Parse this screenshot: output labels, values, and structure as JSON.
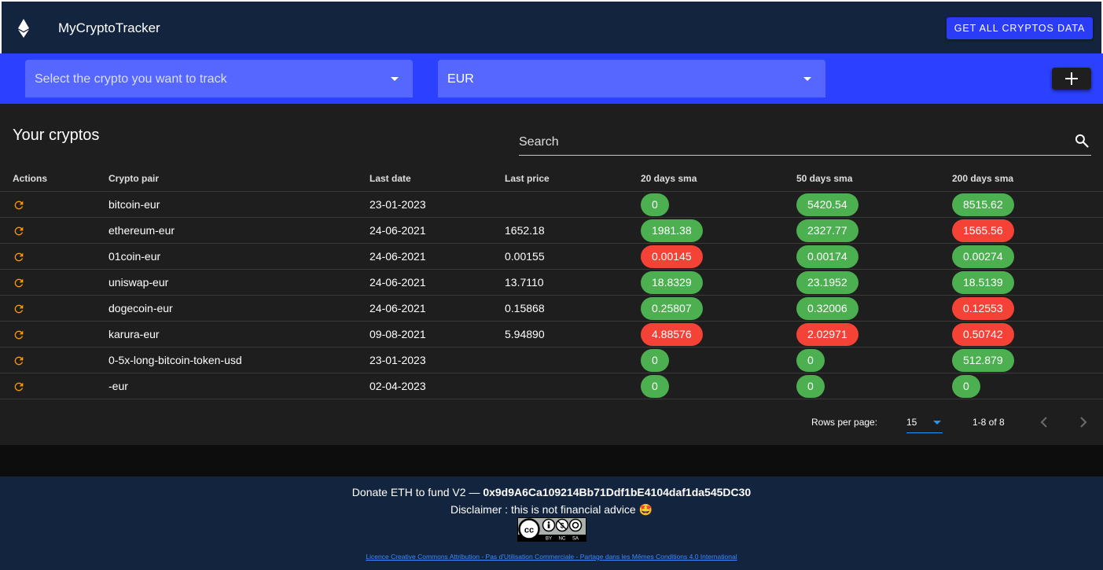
{
  "app": {
    "title": "MyCryptoTracker",
    "get_all_label": "GET ALL CRYPTOS DATA",
    "logo_icon": "ethereum-icon"
  },
  "selectors": {
    "crypto_placeholder": "Select the crypto you want to track",
    "currency_value": "EUR",
    "add_icon": "plus-icon"
  },
  "panel": {
    "title": "Your cryptos",
    "search_placeholder": "Search"
  },
  "table": {
    "headers": [
      "Actions",
      "Crypto pair",
      "Last date",
      "Last price",
      "20 days sma",
      "50 days sma",
      "200 days sma"
    ],
    "rows": [
      {
        "pair": "bitcoin-eur",
        "date": "23-01-2023",
        "price": "",
        "sma20": "0",
        "sma20_color": "green",
        "sma50": "5420.54",
        "sma50_color": "green",
        "sma200": "8515.62",
        "sma200_color": "green"
      },
      {
        "pair": "ethereum-eur",
        "date": "24-06-2021",
        "price": "1652.18",
        "sma20": "1981.38",
        "sma20_color": "green",
        "sma50": "2327.77",
        "sma50_color": "green",
        "sma200": "1565.56",
        "sma200_color": "red"
      },
      {
        "pair": "01coin-eur",
        "date": "24-06-2021",
        "price": "0.00155",
        "sma20": "0.00145",
        "sma20_color": "red",
        "sma50": "0.00174",
        "sma50_color": "green",
        "sma200": "0.00274",
        "sma200_color": "green"
      },
      {
        "pair": "uniswap-eur",
        "date": "24-06-2021",
        "price": "13.7110",
        "sma20": "18.8329",
        "sma20_color": "green",
        "sma50": "23.1952",
        "sma50_color": "green",
        "sma200": "18.5139",
        "sma200_color": "green"
      },
      {
        "pair": "dogecoin-eur",
        "date": "24-06-2021",
        "price": "0.15868",
        "sma20": "0.25807",
        "sma20_color": "green",
        "sma50": "0.32006",
        "sma50_color": "green",
        "sma200": "0.12553",
        "sma200_color": "red"
      },
      {
        "pair": "karura-eur",
        "date": "09-08-2021",
        "price": "5.94890",
        "sma20": "4.88576",
        "sma20_color": "red",
        "sma50": "2.02971",
        "sma50_color": "red",
        "sma200": "0.50742",
        "sma200_color": "red"
      },
      {
        "pair": "0-5x-long-bitcoin-token-usd",
        "date": "23-01-2023",
        "price": "",
        "sma20": "0",
        "sma20_color": "green",
        "sma50": "0",
        "sma50_color": "green",
        "sma200": "512.879",
        "sma200_color": "green"
      },
      {
        "pair": "-eur",
        "date": "02-04-2023",
        "price": "",
        "sma20": "0",
        "sma20_color": "green",
        "sma50": "0",
        "sma50_color": "green",
        "sma200": "0",
        "sma200_color": "green"
      }
    ]
  },
  "pagination": {
    "rows_per_page_label": "Rows per page:",
    "rows_per_page_value": "15",
    "range": "1-8 of 8"
  },
  "footer": {
    "donate_text": "Donate ETH to fund V2 —",
    "eth_address": "0x9d9A6Ca109214Bb71Ddf1bE4104daf1da545DC30",
    "disclaimer": "Disclaimer : this is not financial advice 🤩",
    "cc_badge_text": [
      "BY",
      "NC",
      "SA"
    ],
    "licence": "Licence Creative Commons Attribution - Pas d'Utilisation Commerciale - Partage dans les Mêmes Conditions 4.0 International"
  },
  "colors": {
    "appbar": "#13243e",
    "accent": "#2b41ff",
    "green": "#4caf50",
    "red": "#f44336",
    "refresh": "#ff9800"
  }
}
